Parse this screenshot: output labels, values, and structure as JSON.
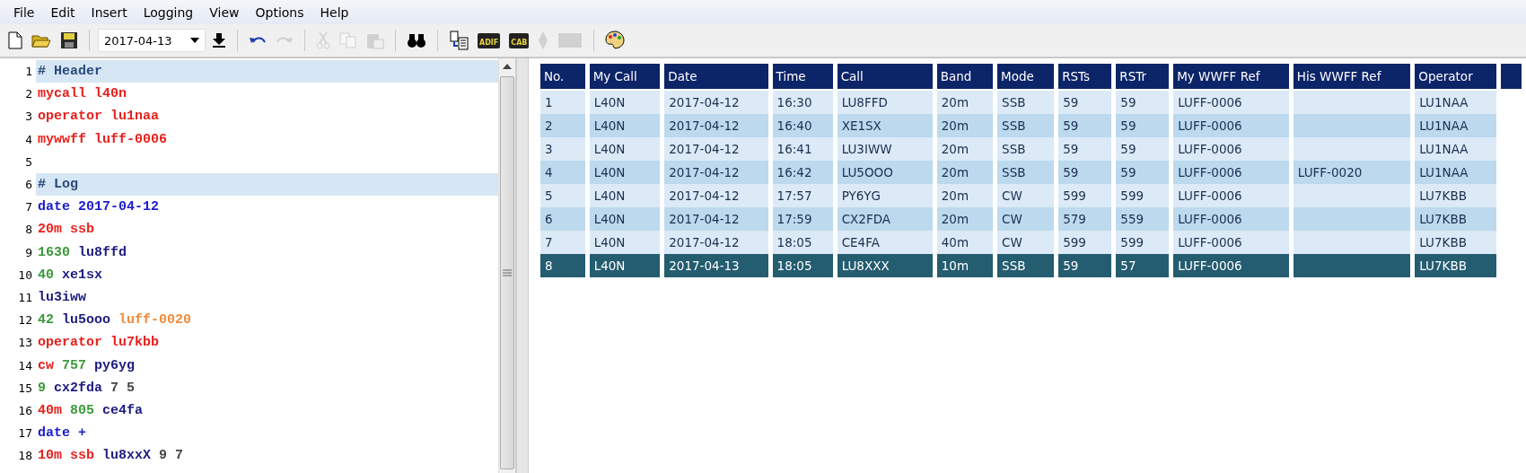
{
  "menu": [
    "File",
    "Edit",
    "Insert",
    "Logging",
    "View",
    "Options",
    "Help"
  ],
  "toolbar": [
    {
      "kind": "new",
      "disabled": false
    },
    {
      "kind": "open",
      "disabled": false
    },
    {
      "kind": "save",
      "disabled": false
    },
    {
      "kind": "sep"
    },
    {
      "kind": "date",
      "value": "2017-04-13"
    },
    {
      "kind": "download",
      "disabled": false
    },
    {
      "kind": "sep"
    },
    {
      "kind": "undo",
      "disabled": false
    },
    {
      "kind": "redo",
      "disabled": true
    },
    {
      "kind": "sep"
    },
    {
      "kind": "cut",
      "disabled": true
    },
    {
      "kind": "copy",
      "disabled": true
    },
    {
      "kind": "paste",
      "disabled": true
    },
    {
      "kind": "sep"
    },
    {
      "kind": "find",
      "disabled": false
    },
    {
      "kind": "sep"
    },
    {
      "kind": "import",
      "disabled": false
    },
    {
      "kind": "disk",
      "label": "ADIF",
      "disabled": false
    },
    {
      "kind": "disk",
      "label": "CAB",
      "disabled": false
    },
    {
      "kind": "diamond",
      "disabled": true
    },
    {
      "kind": "block",
      "disabled": true
    },
    {
      "kind": "sep"
    },
    {
      "kind": "palette",
      "disabled": false
    }
  ],
  "editor": {
    "lines": [
      {
        "number": "1",
        "kind": "comment",
        "tokens": [
          {
            "kind": "comment",
            "text": "# Header"
          }
        ]
      },
      {
        "number": "2",
        "kind": "code",
        "tokens": [
          {
            "kind": "keyword",
            "text": "mycall l40n"
          }
        ]
      },
      {
        "number": "3",
        "kind": "code",
        "tokens": [
          {
            "kind": "keyword",
            "text": "operator lu1naa"
          }
        ]
      },
      {
        "number": "4",
        "kind": "code",
        "tokens": [
          {
            "kind": "keyword",
            "text": "mywwff luff-0006"
          }
        ]
      },
      {
        "number": "5",
        "kind": "code"
      },
      {
        "number": "6",
        "kind": "comment",
        "tokens": [
          {
            "kind": "comment",
            "text": "# Log"
          }
        ]
      },
      {
        "number": "7",
        "kind": "code",
        "tokens": [
          {
            "kind": "date",
            "text": "date 2017-04-12"
          }
        ]
      },
      {
        "number": "8",
        "kind": "code",
        "tokens": [
          {
            "kind": "keyword",
            "text": "20m ssb"
          }
        ]
      },
      {
        "number": "9",
        "kind": "code",
        "tokens": [
          {
            "kind": "number",
            "text": "1630"
          },
          {
            "kind": "call",
            "text": "lu8ffd"
          }
        ]
      },
      {
        "number": "10",
        "kind": "code",
        "tokens": [
          {
            "kind": "number",
            "text": "40"
          },
          {
            "kind": "call",
            "text": "xe1sx"
          }
        ]
      },
      {
        "number": "11",
        "kind": "code",
        "tokens": [
          {
            "kind": "call",
            "text": "lu3iww"
          }
        ]
      },
      {
        "number": "12",
        "kind": "code",
        "tokens": [
          {
            "kind": "number",
            "text": "42"
          },
          {
            "kind": "call",
            "text": "lu5ooo"
          },
          {
            "kind": "ref",
            "text": "luff-0020"
          }
        ]
      },
      {
        "number": "13",
        "kind": "code",
        "tokens": [
          {
            "kind": "keyword",
            "text": "operator lu7kbb"
          }
        ]
      },
      {
        "number": "14",
        "kind": "code",
        "tokens": [
          {
            "kind": "keyword",
            "text": "cw"
          },
          {
            "kind": "number",
            "text": "757"
          },
          {
            "kind": "call",
            "text": "py6yg"
          }
        ]
      },
      {
        "number": "15",
        "kind": "code",
        "tokens": [
          {
            "kind": "number",
            "text": "9"
          },
          {
            "kind": "call",
            "text": "cx2fda"
          },
          {
            "kind": "rst",
            "text": "7 5"
          }
        ]
      },
      {
        "number": "16",
        "kind": "code",
        "tokens": [
          {
            "kind": "keyword",
            "text": "40m"
          },
          {
            "kind": "number",
            "text": "805"
          },
          {
            "kind": "call",
            "text": "ce4fa"
          }
        ]
      },
      {
        "number": "17",
        "kind": "code",
        "tokens": [
          {
            "kind": "date",
            "text": "date +"
          }
        ]
      },
      {
        "number": "18",
        "kind": "code",
        "tokens": [
          {
            "kind": "keyword",
            "text": "10m ssb"
          },
          {
            "kind": "call",
            "text": "lu8xxX"
          },
          {
            "kind": "rst",
            "text": "9 7"
          }
        ]
      }
    ]
  },
  "table": {
    "columns": [
      "No.",
      "My Call",
      "Date",
      "Time",
      "Call",
      "Band",
      "Mode",
      "RSTs",
      "RSTr",
      "My WWFF Ref",
      "His WWFF Ref",
      "Operator"
    ],
    "rows": [
      {
        "selected": false,
        "cells": [
          "1",
          "L40N",
          "2017-04-12",
          "16:30",
          "LU8FFD",
          "20m",
          "SSB",
          "59",
          "59",
          "LUFF-0006",
          "",
          "LU1NAA"
        ]
      },
      {
        "selected": false,
        "cells": [
          "2",
          "L40N",
          "2017-04-12",
          "16:40",
          "XE1SX",
          "20m",
          "SSB",
          "59",
          "59",
          "LUFF-0006",
          "",
          "LU1NAA"
        ]
      },
      {
        "selected": false,
        "cells": [
          "3",
          "L40N",
          "2017-04-12",
          "16:41",
          "LU3IWW",
          "20m",
          "SSB",
          "59",
          "59",
          "LUFF-0006",
          "",
          "LU1NAA"
        ]
      },
      {
        "selected": false,
        "cells": [
          "4",
          "L40N",
          "2017-04-12",
          "16:42",
          "LU5OOO",
          "20m",
          "SSB",
          "59",
          "59",
          "LUFF-0006",
          "LUFF-0020",
          "LU1NAA"
        ]
      },
      {
        "selected": false,
        "cells": [
          "5",
          "L40N",
          "2017-04-12",
          "17:57",
          "PY6YG",
          "20m",
          "CW",
          "599",
          "599",
          "LUFF-0006",
          "",
          "LU7KBB"
        ]
      },
      {
        "selected": false,
        "cells": [
          "6",
          "L40N",
          "2017-04-12",
          "17:59",
          "CX2FDA",
          "20m",
          "CW",
          "579",
          "559",
          "LUFF-0006",
          "",
          "LU7KBB"
        ]
      },
      {
        "selected": false,
        "cells": [
          "7",
          "L40N",
          "2017-04-12",
          "18:05",
          "CE4FA",
          "40m",
          "CW",
          "599",
          "599",
          "LUFF-0006",
          "",
          "LU7KBB"
        ]
      },
      {
        "selected": true,
        "cells": [
          "8",
          "L40N",
          "2017-04-13",
          "18:05",
          "LU8XXX",
          "10m",
          "SSB",
          "59",
          "57",
          "LUFF-0006",
          "",
          "LU7KBB"
        ]
      }
    ]
  }
}
